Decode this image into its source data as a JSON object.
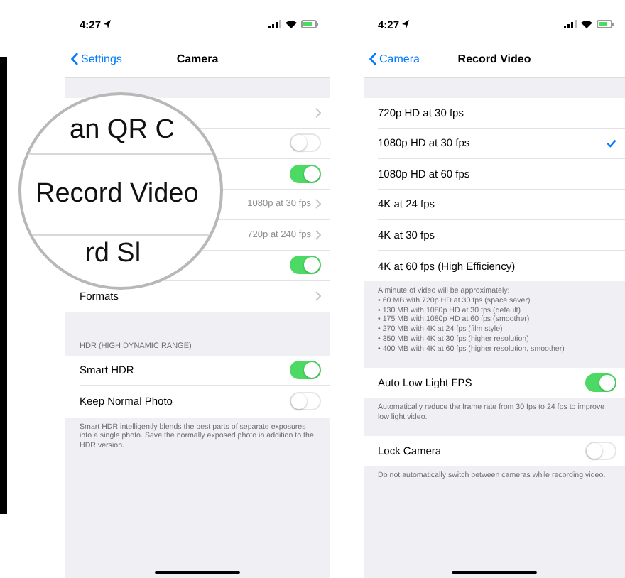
{
  "phones": [
    {
      "status": {
        "time": "4:27"
      },
      "nav": {
        "back": "Settings",
        "title": "Camera"
      },
      "sections": [
        {
          "rows": [
            {
              "kind": "link"
            },
            {
              "kind": "toggle",
              "on": false
            },
            {
              "kind": "toggle",
              "on": true
            },
            {
              "kind": "link",
              "value": "1080p at 30 fps"
            },
            {
              "kind": "link",
              "value": "720p at 240 fps"
            },
            {
              "kind": "toggle",
              "on": true
            },
            {
              "kind": "link",
              "label": "Formats"
            }
          ]
        },
        {
          "header": "HDR (HIGH DYNAMIC RANGE)",
          "rows": [
            {
              "kind": "toggle",
              "label": "Smart HDR",
              "on": true
            },
            {
              "kind": "toggle",
              "label": "Keep Normal Photo",
              "on": false
            }
          ],
          "footer": [
            "Smart HDR intelligently blends the best parts of separate exposures into a single photo. Save the normally exposed photo in addition to the HDR version."
          ]
        }
      ]
    },
    {
      "status": {
        "time": "4:27"
      },
      "nav": {
        "back": "Camera",
        "title": "Record Video"
      },
      "sections": [
        {
          "rows": [
            {
              "kind": "choice",
              "label": "720p HD at 30 fps",
              "selected": false
            },
            {
              "kind": "choice",
              "label": "1080p HD at 30 fps",
              "selected": true
            },
            {
              "kind": "choice",
              "label": "1080p HD at 60 fps",
              "selected": false
            },
            {
              "kind": "choice",
              "label": "4K at 24 fps",
              "selected": false
            },
            {
              "kind": "choice",
              "label": "4K at 30 fps",
              "selected": false
            },
            {
              "kind": "choice",
              "label": "4K at 60 fps (High Efficiency)",
              "selected": false
            }
          ],
          "footer": [
            "A minute of video will be approximately:",
            "• 60 MB with 720p HD at 30 fps (space saver)",
            "• 130 MB with 1080p HD at 30 fps (default)",
            "• 175 MB with 1080p HD at 60 fps (smoother)",
            "• 270 MB with 4K at 24 fps (film style)",
            "• 350 MB with 4K at 30 fps (higher resolution)",
            "• 400 MB with 4K at 60 fps (higher resolution, smoother)"
          ]
        },
        {
          "rows": [
            {
              "kind": "toggle",
              "label": "Auto Low Light FPS",
              "on": true
            }
          ],
          "footer": [
            "Automatically reduce the frame rate from 30 fps to 24 fps to improve low light video."
          ]
        },
        {
          "rows": [
            {
              "kind": "toggle",
              "label": "Lock Camera",
              "on": false
            }
          ],
          "footer": [
            "Do not automatically switch between cameras while recording video."
          ]
        }
      ]
    }
  ],
  "magnifier": {
    "lines": [
      "an QR C",
      "Record Video",
      "rd Sl"
    ]
  }
}
